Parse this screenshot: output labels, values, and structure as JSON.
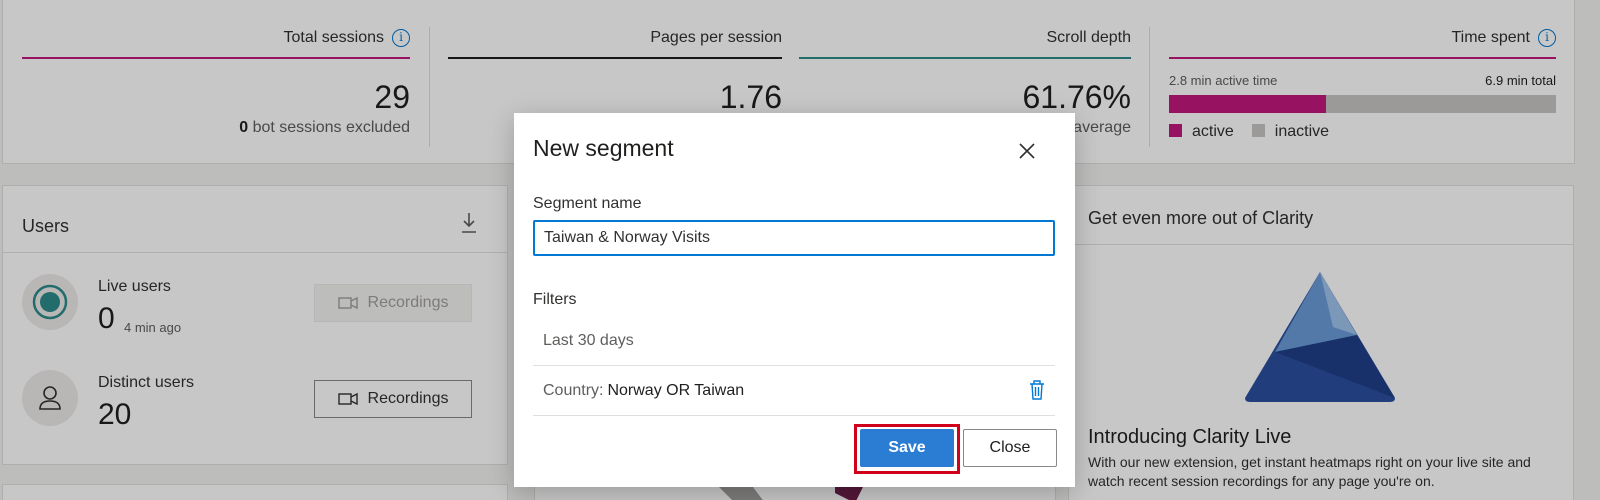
{
  "metrics": {
    "total_sessions": {
      "title": "Total sessions",
      "value": "29",
      "sub_count": "0",
      "sub_text": " bot sessions excluded"
    },
    "pages_per_session": {
      "title": "Pages per session",
      "value": "1.76"
    },
    "scroll_depth": {
      "title": "Scroll depth",
      "value": "61.76%",
      "sub_text": "average"
    },
    "time_spent": {
      "title": "Time spent",
      "active_label": "2.8 min active time",
      "total_label": "6.9 min total",
      "active_fraction": 0.406,
      "legend_active": "active",
      "legend_inactive": "inactive"
    }
  },
  "colors": {
    "accent_pink": "#c2187b",
    "teal": "#2e8b8b",
    "primary_blue": "#2b7cd3",
    "highlight_red": "#d0021b"
  },
  "users": {
    "title": "Users",
    "download_icon": "download-icon",
    "live": {
      "label": "Live users",
      "count": "0",
      "ago": "4 min ago",
      "button": "Recordings"
    },
    "distinct": {
      "label": "Distinct users",
      "count": "20",
      "button": "Recordings"
    }
  },
  "promo": {
    "title": "Get even more out of Clarity",
    "heading": "Introducing Clarity Live",
    "body": "With our new extension, get instant heatmaps right on your live site and watch recent session recordings for any page you're on."
  },
  "modal": {
    "title": "New segment",
    "field_label": "Segment name",
    "field_value": "Taiwan & Norway Visits",
    "filters_label": "Filters",
    "filter_date": "Last 30 days",
    "filter_country_key": "Country:",
    "filter_country_value": "Norway OR Taiwan",
    "save_label": "Save",
    "close_label": "Close"
  }
}
